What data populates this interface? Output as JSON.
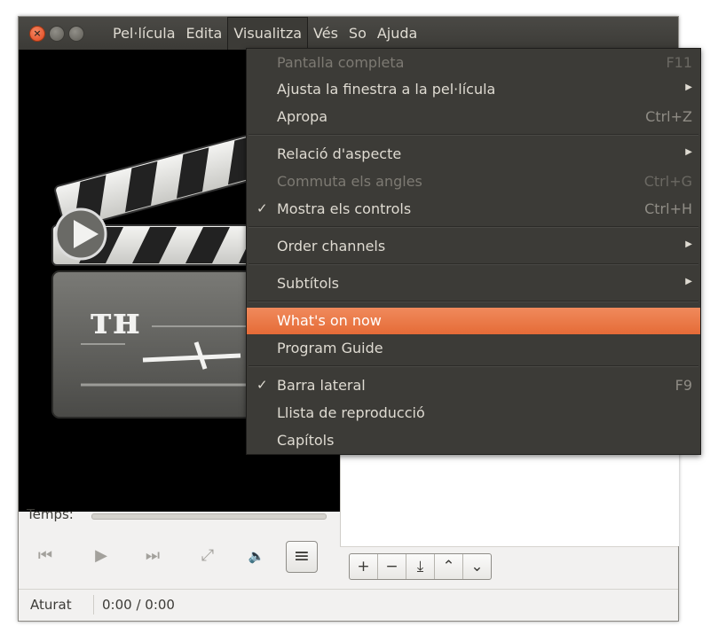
{
  "menubar": {
    "items": [
      "Pel·lícula",
      "Edita",
      "Visualitza",
      "Vés",
      "So",
      "Ajuda"
    ],
    "open_index": 2
  },
  "view_menu": {
    "items": [
      {
        "label": "Pantalla completa",
        "accel": "F11",
        "disabled": true,
        "checked": false,
        "submenu": false
      },
      {
        "label": "Ajusta la finestra a la pel·lícula",
        "accel": "",
        "disabled": false,
        "checked": false,
        "submenu": true
      },
      {
        "label": "Apropa",
        "accel": "Ctrl+Z",
        "disabled": false,
        "checked": false,
        "submenu": false
      },
      {
        "label": "Relació d'aspecte",
        "accel": "",
        "disabled": false,
        "checked": false,
        "submenu": true
      },
      {
        "label": "Commuta els angles",
        "accel": "Ctrl+G",
        "disabled": true,
        "checked": false,
        "submenu": false
      },
      {
        "label": "Mostra els controls",
        "accel": "Ctrl+H",
        "disabled": false,
        "checked": true,
        "submenu": false
      },
      {
        "label": "Order channels",
        "accel": "",
        "disabled": false,
        "checked": false,
        "submenu": true
      },
      {
        "label": "Subtítols",
        "accel": "",
        "disabled": false,
        "checked": false,
        "submenu": true
      },
      {
        "label": "What's on now",
        "accel": "",
        "disabled": false,
        "checked": false,
        "submenu": false,
        "highlighted": true
      },
      {
        "label": "Program Guide",
        "accel": "",
        "disabled": false,
        "checked": false,
        "submenu": false
      },
      {
        "label": "Barra lateral",
        "accel": "F9",
        "disabled": false,
        "checked": true,
        "submenu": false
      },
      {
        "label": "Llista de reproducció",
        "accel": "",
        "disabled": false,
        "checked": false,
        "submenu": false
      },
      {
        "label": "Capítols",
        "accel": "",
        "disabled": false,
        "checked": false,
        "submenu": false
      }
    ]
  },
  "player": {
    "time_label": "Temps:",
    "status": "Aturat",
    "time": "0:00 / 0:00"
  },
  "icons": {
    "previous": "skip-back-icon",
    "play": "play-icon",
    "next": "skip-forward-icon",
    "fullscreen": "fullscreen-icon",
    "volume": "volume-muted-icon",
    "sidebar_toggle": "menu-icon",
    "check": "✓",
    "submenu_arrow": "▶"
  },
  "sidebar_toolbar": {
    "add": "+",
    "remove": "−",
    "save": "⤓",
    "up": "⌃",
    "down": "⌄"
  },
  "colors": {
    "menu_bg": "#3c3b37",
    "highlight": "#e9743f",
    "close_button": "#e0451d"
  }
}
